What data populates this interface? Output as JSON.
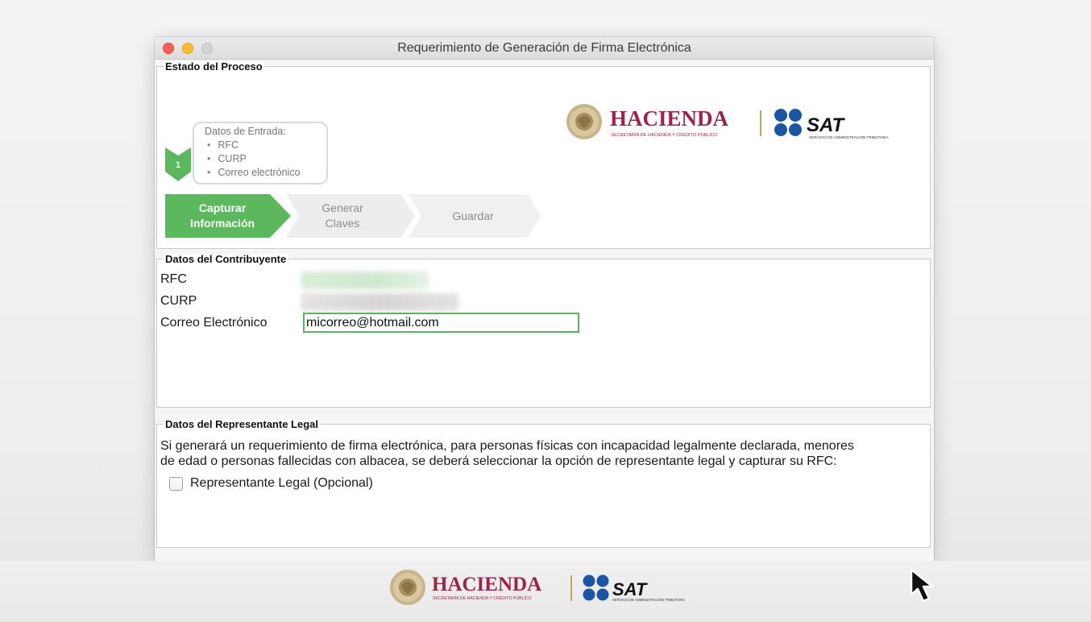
{
  "window": {
    "title": "Requerimiento de Generación de Firma Electrónica"
  },
  "estado": {
    "legend": "Estado del Proceso",
    "step_number": "1",
    "info_title": "Datos de Entrada:",
    "info_items": [
      "RFC",
      "CURP",
      "Correo electrónico"
    ],
    "steps": [
      {
        "line1": "Capturar",
        "line2": "Información",
        "active": true
      },
      {
        "line1": "Generar",
        "line2": "Claves",
        "active": false
      },
      {
        "line1": "Guardar",
        "line2": "",
        "active": false
      }
    ]
  },
  "logos": {
    "hacienda": "HACIENDA",
    "hacienda_sub": "SECRETARÍA DE HACIENDA Y CRÉDITO PÚBLICO",
    "sat": "SAT",
    "sat_sub": "SERVICIO DE ADMINISTRACIÓN TRIBUTARIA"
  },
  "contribuyente": {
    "legend": "Datos del Contribuyente",
    "rfc_label": "RFC",
    "curp_label": "CURP",
    "email_label": "Correo Electrónico",
    "email_value": "micorreo@hotmail.com"
  },
  "representante": {
    "legend": "Datos del Representante Legal",
    "description_line1": "Si generará un requerimiento de firma electrónica, para personas físicas con incapacidad legalmente declarada, menores",
    "description_line2": "de edad o personas fallecidas con albacea, se deberá seleccionar la opción de representante legal y capturar su RFC:",
    "checkbox_label": "Representante Legal (Opcional)",
    "checkbox_checked": false
  },
  "colors": {
    "accent_green": "#5cb85c",
    "hacienda_red": "#9d2449",
    "sat_blue": "#1b56a5"
  }
}
